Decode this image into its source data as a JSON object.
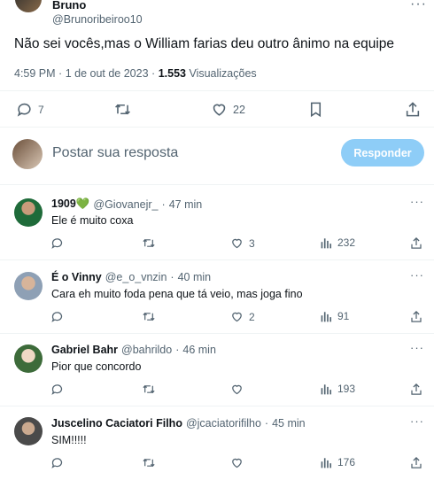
{
  "tweet": {
    "author_name": "Bruno",
    "author_handle": "@Brunoribeiroo10",
    "text": "Não sei vocês,mas o William farias deu outro ânimo na equipe",
    "time": "4:59 PM",
    "sep": "·",
    "date": "1 de out de 2023",
    "views_count": "1.553",
    "views_label": "Visualizações",
    "replies": "7",
    "likes": "22",
    "more": "···"
  },
  "reply_box": {
    "placeholder": "Postar sua resposta",
    "button": "Responder"
  },
  "replies": [
    {
      "name": "1909💚",
      "handle": "@Giovanejr_",
      "sep": "·",
      "time": "47 min",
      "text": "Ele é muito coxa",
      "likes": "3",
      "views": "232"
    },
    {
      "name": "É o Vinny",
      "handle": "@e_o_vnzin",
      "sep": "·",
      "time": "40 min",
      "text": "Cara eh muito foda pena que tá veio, mas joga fino",
      "likes": "2",
      "views": "91"
    },
    {
      "name": "Gabriel Bahr",
      "handle": "@bahrildo",
      "sep": "·",
      "time": "46 min",
      "text": "Pior que concordo",
      "likes": "",
      "views": "193"
    },
    {
      "name": "Juscelino Caciatori Filho",
      "handle": "@jcaciatorifilho",
      "sep": "·",
      "time": "45 min",
      "text": "SIM!!!!!",
      "likes": "",
      "views": "176"
    }
  ],
  "colors": {
    "accent": "#1d9bf0",
    "reply_button": "#8ecdf7",
    "muted": "#536471",
    "text": "#0f1419"
  }
}
